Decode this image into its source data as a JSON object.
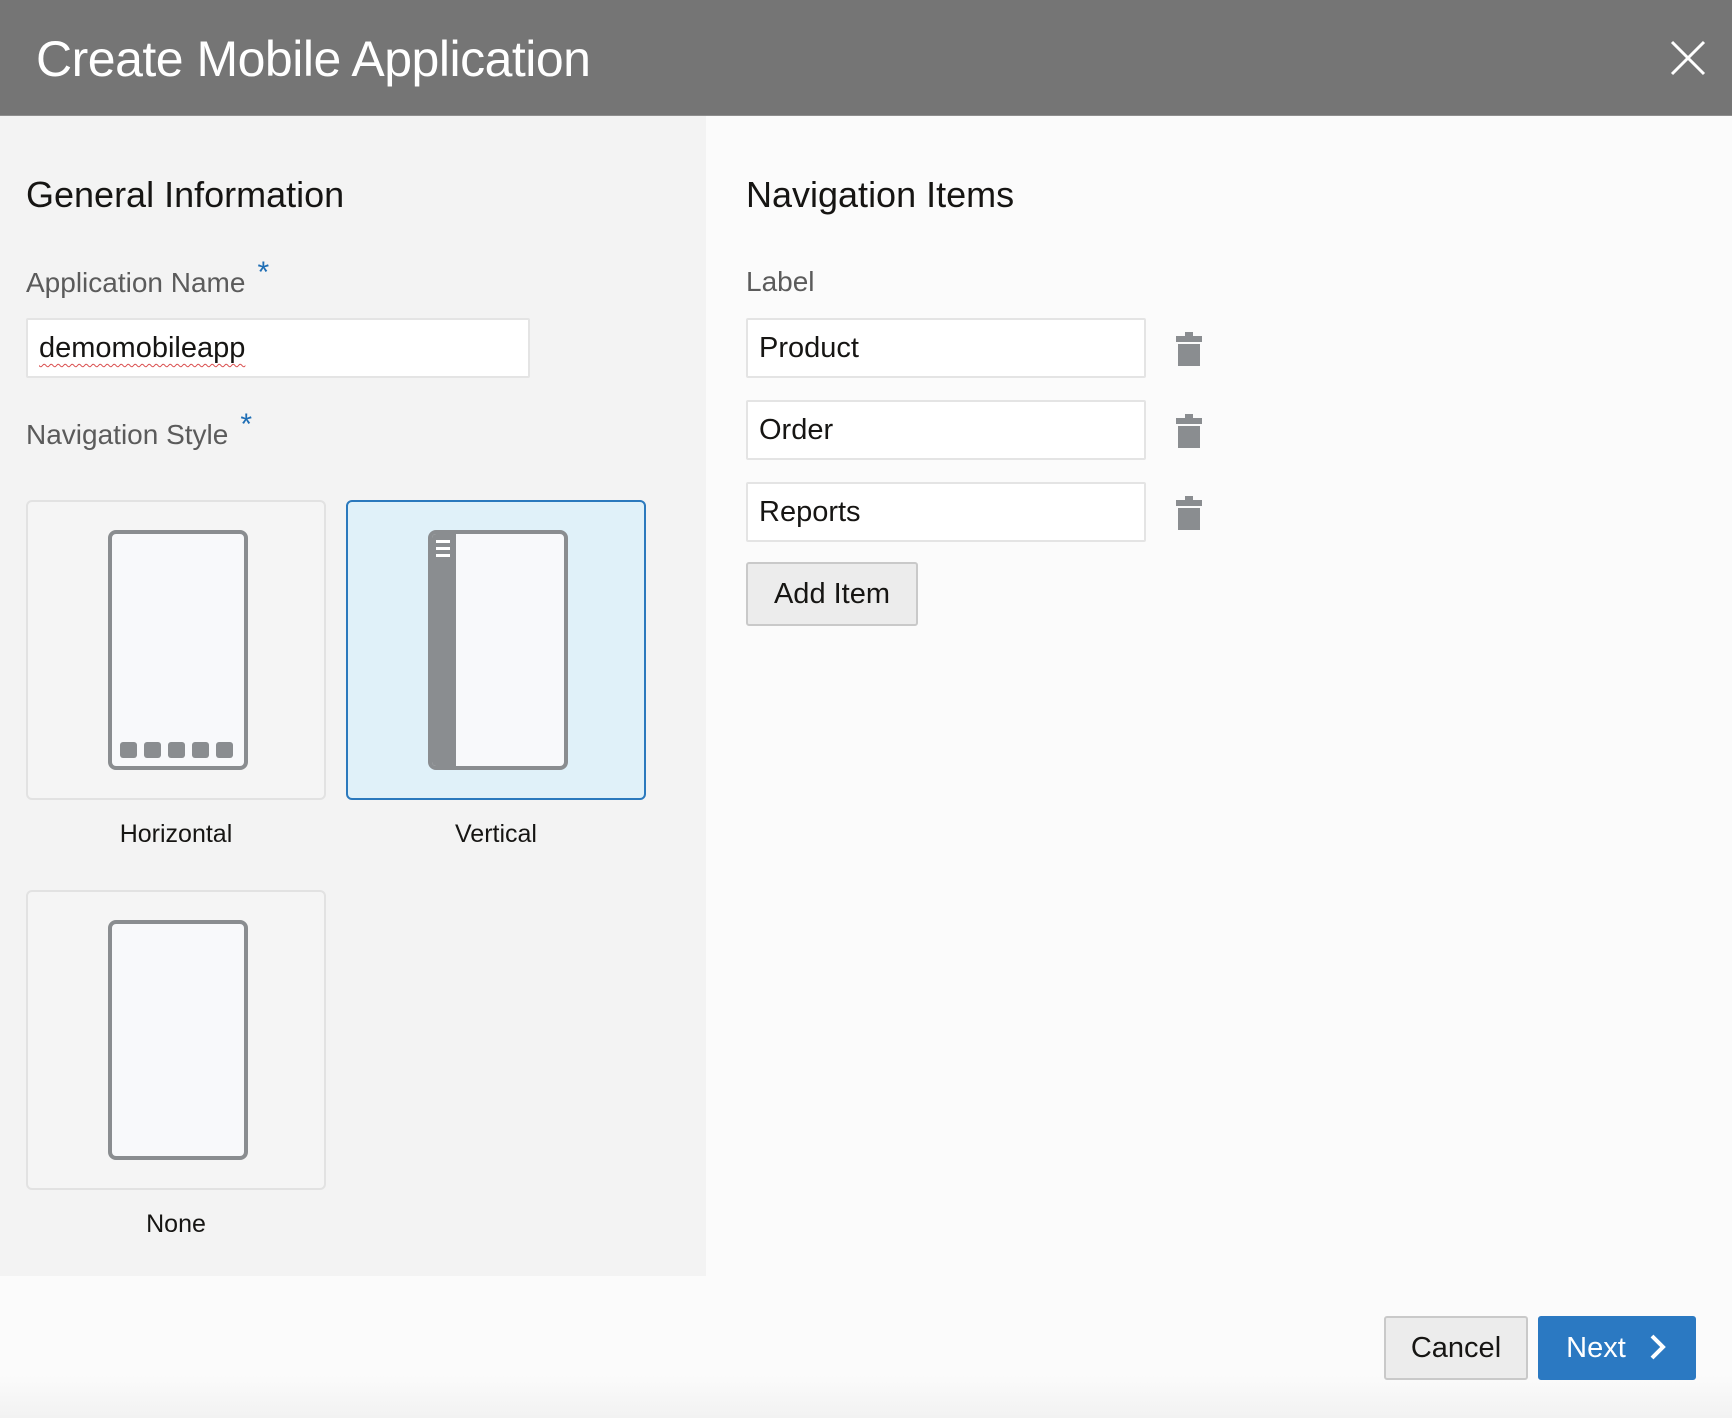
{
  "dialog": {
    "title": "Create Mobile Application",
    "close_icon": "close-icon"
  },
  "general": {
    "section_title": "General Information",
    "app_name_label": "Application Name",
    "required_marker": "*",
    "app_name_value": "demomobileapp",
    "nav_style_label": "Navigation Style",
    "styles": [
      {
        "label": "Horizontal",
        "icon": "phone-horizontal-nav-icon",
        "selected": false
      },
      {
        "label": "Vertical",
        "icon": "phone-vertical-nav-icon",
        "selected": true
      },
      {
        "label": "None",
        "icon": "phone-no-nav-icon",
        "selected": false
      }
    ]
  },
  "navigation": {
    "section_title": "Navigation Items",
    "label_header": "Label",
    "items": [
      {
        "label": "Product",
        "delete_icon": "trash-icon"
      },
      {
        "label": "Order",
        "delete_icon": "trash-icon"
      },
      {
        "label": "Reports",
        "delete_icon": "trash-icon"
      }
    ],
    "add_item_label": "Add Item"
  },
  "footer": {
    "cancel_label": "Cancel",
    "next_label": "Next",
    "next_icon": "chevron-right-icon"
  },
  "colors": {
    "titlebar": "#757575",
    "accent": "#2b79c2",
    "selected_card_bg": "#e0f1f9",
    "required_marker": "#1e6eb5"
  }
}
